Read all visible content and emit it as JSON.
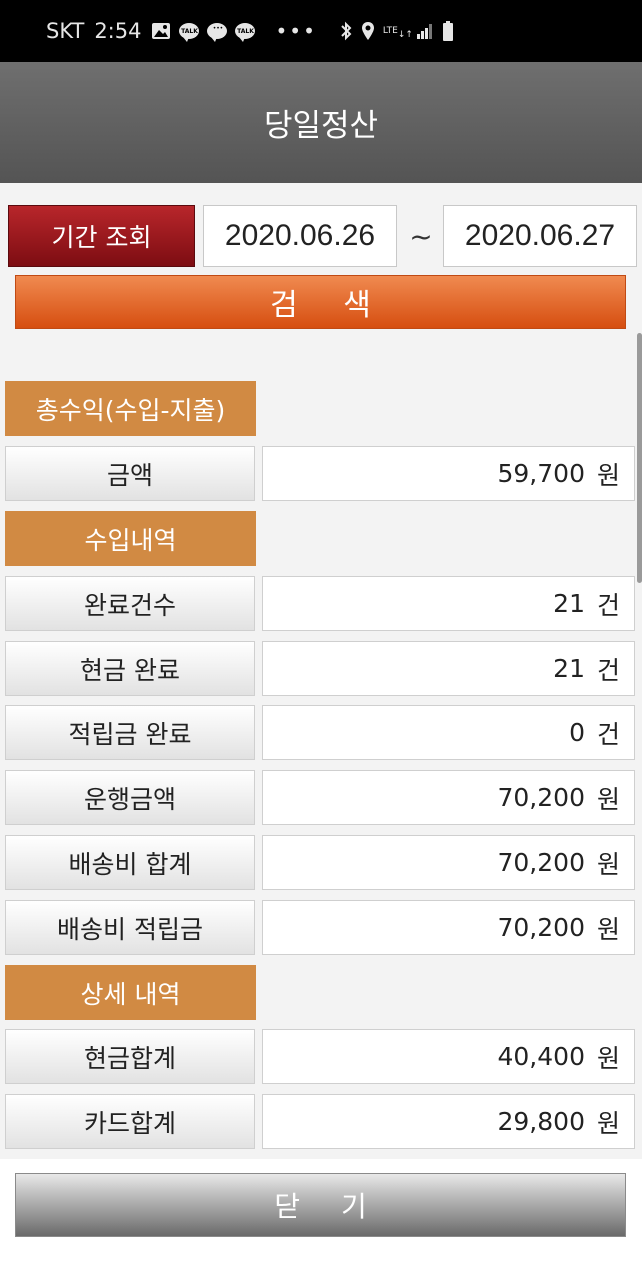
{
  "status_bar": {
    "carrier": "SKT",
    "time": "2:54",
    "talk_badge": "TALK",
    "network": "LTE",
    "icons": [
      "image-icon",
      "kakaotalk-icon",
      "kakaotalk-icon",
      "chat-icon",
      "more-dots-icon",
      "bluetooth-icon",
      "location-icon",
      "lte-signal-icon",
      "signal-icon",
      "battery-icon"
    ]
  },
  "header": {
    "title": "당일정산"
  },
  "filter": {
    "period_button": "기간 조회",
    "start_date": "2020.06.26",
    "separator": "~",
    "end_date": "2020.06.27",
    "search_button": "검 색"
  },
  "sections": {
    "profit": {
      "title": "총수익(수입-지출)",
      "rows": [
        {
          "label": "금액",
          "value": "59,700",
          "unit": "원"
        }
      ]
    },
    "income": {
      "title": "수입내역",
      "rows": [
        {
          "label": "완료건수",
          "value": "21",
          "unit": "건"
        },
        {
          "label": "현금 완료",
          "value": "21",
          "unit": "건"
        },
        {
          "label": "적립금 완료",
          "value": "0",
          "unit": "건"
        },
        {
          "label": "운행금액",
          "value": "70,200",
          "unit": "원"
        },
        {
          "label": "배송비 합계",
          "value": "70,200",
          "unit": "원"
        },
        {
          "label": "배송비 적립금",
          "value": "70,200",
          "unit": "원"
        }
      ]
    },
    "detail": {
      "title": "상세 내역",
      "rows": [
        {
          "label": "현금합계",
          "value": "40,400",
          "unit": "원"
        },
        {
          "label": "카드합계",
          "value": "29,800",
          "unit": "원"
        }
      ]
    }
  },
  "footer": {
    "close_button": "닫 기"
  },
  "colors": {
    "header_bg": "#5e5e5e",
    "period_button": "#9c1a20",
    "search_button": "#e2632a",
    "section_label": "#d18a43"
  }
}
